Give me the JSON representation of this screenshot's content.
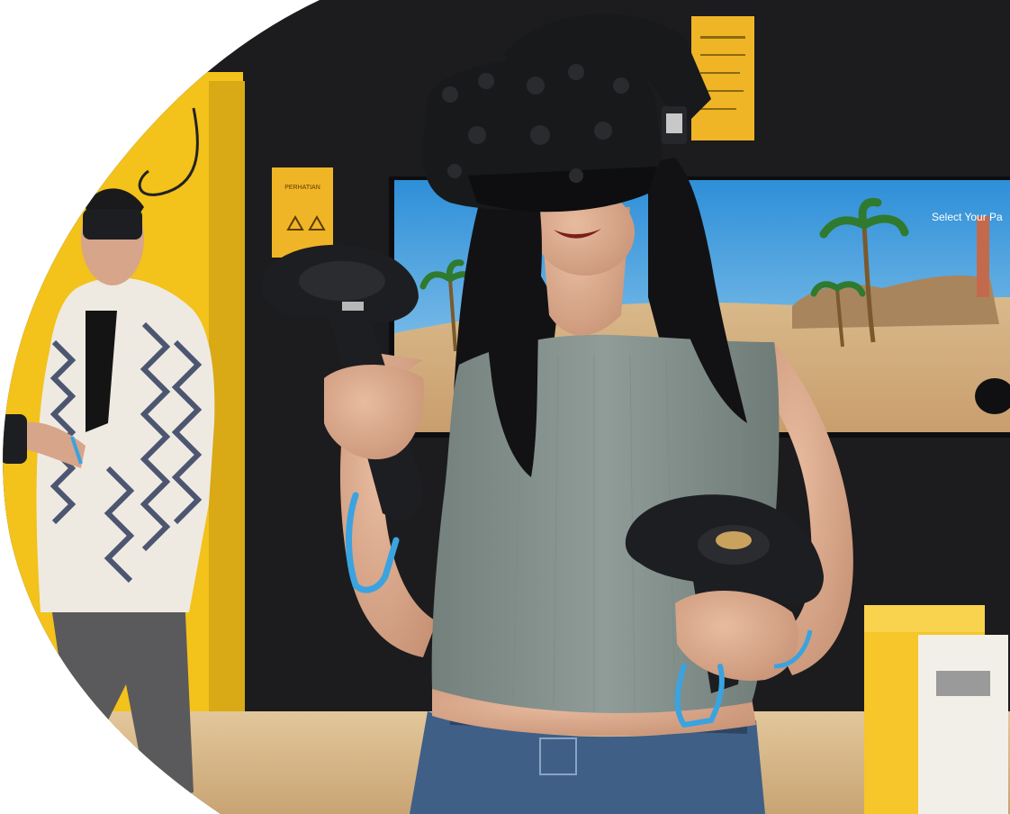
{
  "image": {
    "kind": "photograph",
    "frame_shape": "organic-blob-crop",
    "background": "#ffffff",
    "colors": {
      "wall_black": "#1c1c1e",
      "wall_yellow": "#f3c21b",
      "floor": "#d8b98a",
      "sky_top": "#2e8fd8",
      "sky_bottom": "#9fd2ef",
      "sand": "#d9b98a",
      "headset": "#18191b",
      "controller": "#1d1e21",
      "strap_blue": "#3aa3e0",
      "top_grey": "#8b9793",
      "jeans": "#3f5f86",
      "skin": "#d9a98c",
      "hair": "#121214",
      "jacket": "#eeeae2",
      "jacket_pattern": "#4d5670",
      "trousers": "#5a5a5c",
      "cabinet_yellow": "#f6c62a",
      "sign_yellow": "#f0b526"
    },
    "subjects": [
      {
        "id": "woman-vr",
        "label": "woman wearing VR headset holding two controllers"
      },
      {
        "id": "man-background",
        "label": "man in patterned jacket holding VR controller"
      }
    ],
    "screen_text": "Select Your Pa",
    "sign_heading": "PERHATIAN"
  }
}
